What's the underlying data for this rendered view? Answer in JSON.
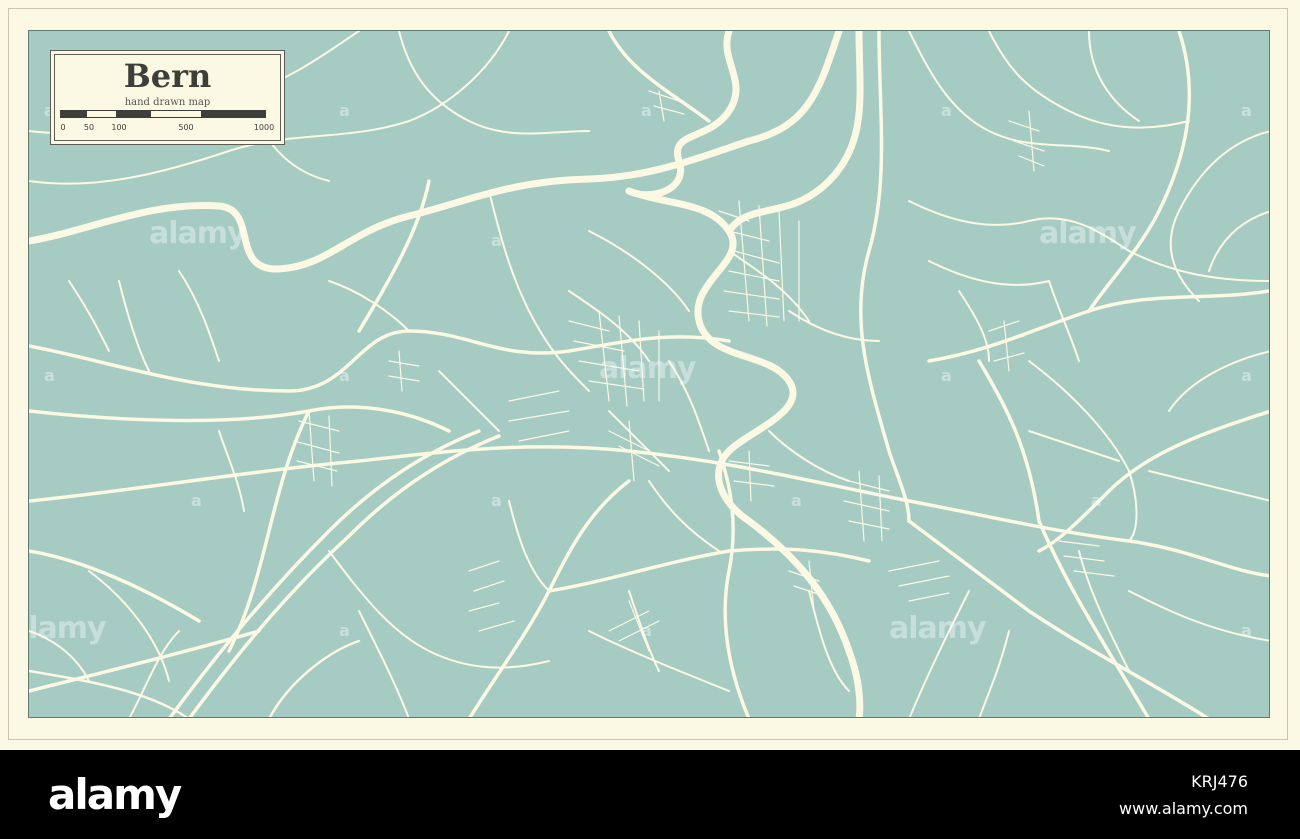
{
  "map": {
    "title": "Bern",
    "subtitle": "hand drawn map",
    "scale_labels": [
      "0",
      "50",
      "100",
      "500",
      "1000"
    ],
    "colors": {
      "background": "#fbf8e4",
      "land": "#a5cbc3",
      "roads": "#fbf8e4",
      "ink": "#3e3e3a"
    }
  },
  "watermark": {
    "text": "alamy",
    "letter": "a"
  },
  "footer": {
    "brand": "alamy",
    "image_id": "KRJ476",
    "url": "www.alamy.com"
  }
}
